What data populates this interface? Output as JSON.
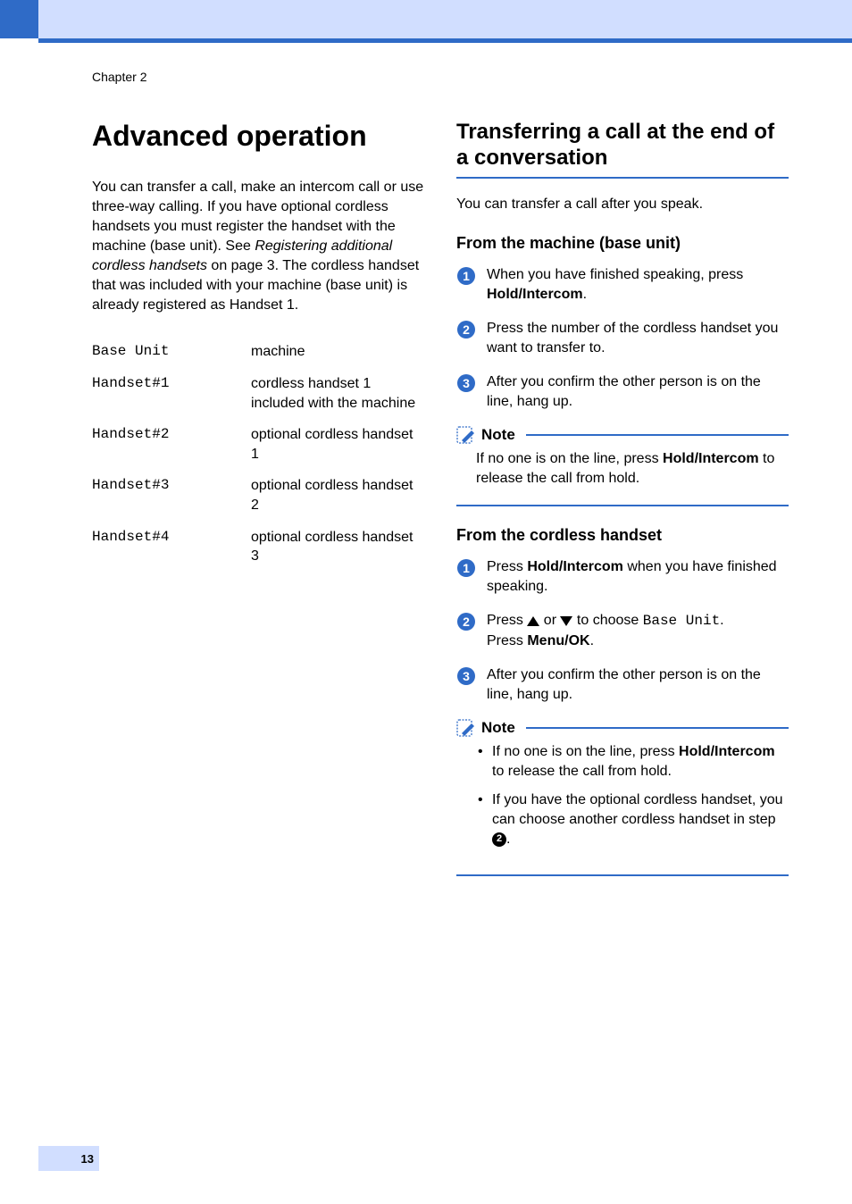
{
  "chapter_label": "Chapter 2",
  "page_number": "13",
  "left": {
    "heading": "Advanced operation",
    "intro_before_italic": "You can transfer a call, make an intercom call or use three-way calling. If you have optional cordless handsets you must register the handset with the machine (base unit). See ",
    "intro_italic": "Registering additional cordless handsets",
    "intro_after_italic": " on page 3. The cordless handset that was included with your machine (base unit) is already registered as Handset 1.",
    "table": [
      {
        "key": "Base Unit",
        "val": "machine"
      },
      {
        "key": "Handset#1",
        "val": "cordless handset 1 included with the machine"
      },
      {
        "key": "Handset#2",
        "val": "optional cordless handset 1"
      },
      {
        "key": "Handset#3",
        "val": "optional cordless handset 2"
      },
      {
        "key": "Handset#4",
        "val": "optional cordless handset 3"
      }
    ]
  },
  "right": {
    "heading": "Transferring a call at the end of a conversation",
    "intro": "You can transfer a call after you speak.",
    "section_a": {
      "heading": "From the machine (base unit)",
      "steps": [
        {
          "pre": "When you have finished speaking, press ",
          "bold": "Hold/Intercom",
          "post": "."
        },
        {
          "pre": "Press the number of the cordless handset you want to transfer to.",
          "bold": "",
          "post": ""
        },
        {
          "pre": "After you confirm the other person is on the line, hang up.",
          "bold": "",
          "post": ""
        }
      ],
      "note": {
        "label": "Note",
        "text_pre": "If no one is on the line, press ",
        "text_bold": "Hold/Intercom",
        "text_post": " to release the call from hold."
      }
    },
    "section_b": {
      "heading": "From the cordless handset",
      "steps": {
        "s1_pre": "Press ",
        "s1_bold": "Hold/Intercom",
        "s1_post": " when you have finished speaking.",
        "s2_pre": "Press ",
        "s2_mid": " or ",
        "s2_choose": " to choose ",
        "s2_mono": "Base Unit",
        "s2_post1": ".",
        "s2_press": "Press ",
        "s2_bold": "Menu/OK",
        "s2_post2": ".",
        "s3": "After you confirm the other person is on the line, hang up."
      },
      "note": {
        "label": "Note",
        "bullet1_pre": "If no one is on the line, press ",
        "bullet1_bold": "Hold/Intercom",
        "bullet1_post": " to release the call from hold.",
        "bullet2_pre": "If you have the optional cordless handset, you can choose another cordless handset in step ",
        "bullet2_circle": "2",
        "bullet2_post": "."
      }
    }
  }
}
